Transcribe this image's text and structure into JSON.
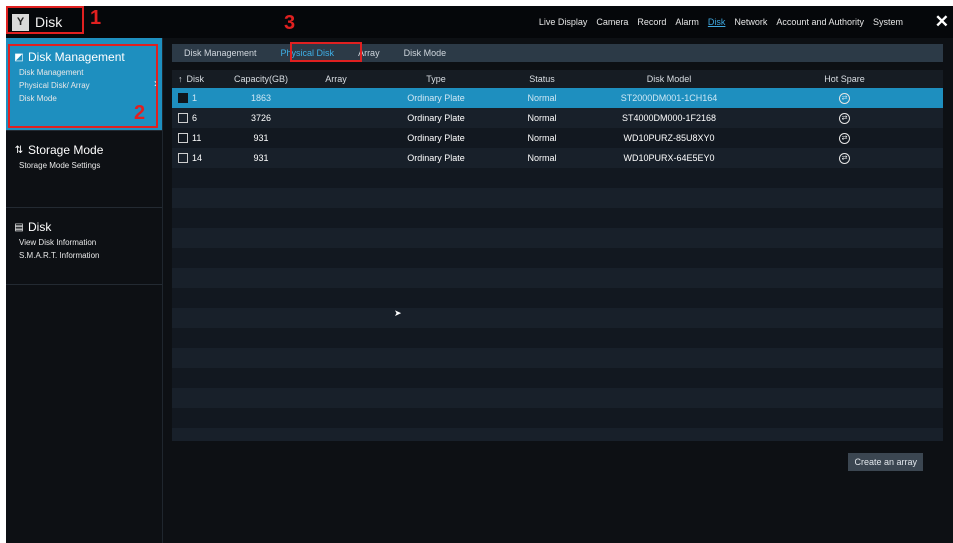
{
  "app": {
    "title": "Disk",
    "icon": "disk-app-icon"
  },
  "nav": [
    "Live Display",
    "Camera",
    "Record",
    "Alarm",
    "Disk",
    "Network",
    "Account and Authority",
    "System"
  ],
  "nav_active_index": 4,
  "annotations": [
    "1",
    "2",
    "3"
  ],
  "sidebar": {
    "sections": [
      {
        "title": "Disk Management",
        "items": [
          "Disk Management",
          "Physical Disk/ Array",
          "Disk Mode"
        ]
      },
      {
        "title": "Storage Mode",
        "items": [
          "Storage Mode Settings"
        ]
      },
      {
        "title": "Disk",
        "items": [
          "View Disk Information",
          "S.M.A.R.T. Information"
        ]
      }
    ]
  },
  "tabs": [
    "Disk Management",
    "Physical Disk",
    "Array",
    "Disk Mode"
  ],
  "table": {
    "columns": [
      "Disk",
      "Capacity(GB)",
      "Array",
      "Type",
      "Status",
      "Disk Model",
      "Hot Spare"
    ],
    "rows": [
      {
        "disk": "1",
        "capacity": "1863",
        "array": "",
        "type": "Ordinary Plate",
        "status": "Normal",
        "model": "ST2000DM001-1CH164",
        "selected": true
      },
      {
        "disk": "6",
        "capacity": "3726",
        "array": "",
        "type": "Ordinary Plate",
        "status": "Normal",
        "model": "ST4000DM000-1F2168",
        "selected": false
      },
      {
        "disk": "11",
        "capacity": "931",
        "array": "",
        "type": "Ordinary Plate",
        "status": "Normal",
        "model": "WD10PURZ-85U8XY0",
        "selected": false
      },
      {
        "disk": "14",
        "capacity": "931",
        "array": "",
        "type": "Ordinary Plate",
        "status": "Normal",
        "model": "WD10PURX-64E5EY0",
        "selected": false
      }
    ]
  },
  "buttons": {
    "create_array": "Create an array"
  },
  "colors": {
    "accent": "#1e8fbf",
    "annotation": "#e02020"
  }
}
